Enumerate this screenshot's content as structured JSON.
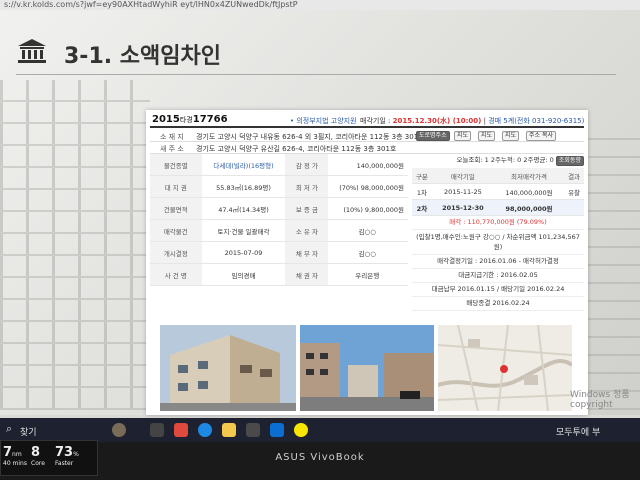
{
  "browser": {
    "url": "s://v.kr.kolds.com/s?jwf=ey90AXHtadWyhiR eyt/lHN0x4ZUNwedDk/ftJpstP"
  },
  "slide": {
    "title": "3-1. 소액임차인"
  },
  "case": {
    "year": "2015",
    "type": "타경",
    "number": "17766",
    "court": "의정부지법 고양지원",
    "sale_label": "매각기일 :",
    "sale_date": "2015.12.30(水) (10:00)",
    "dept": "경매 5계(전화 031-920-6315)"
  },
  "location": {
    "label": "소 재 지",
    "value": "경기도 고양시 덕양구 내유동 626-4 외 3필지, 코리아타운 112동 3층 301호",
    "btn_road": "도로명주소"
  },
  "new_address": {
    "label": "새 주 소",
    "value": "경기도 고양시 덕양구 유산길 626-4, 코리아타운 112동 3층 301호"
  },
  "map_buttons": [
    "지도",
    "지도",
    "지도",
    "주소 복사"
  ],
  "info_rows": [
    {
      "k1": "물건종별",
      "v1": "다세대(빌라)(16평형)",
      "k2": "감 정 가",
      "v2": "140,000,000원"
    },
    {
      "k1": "대 지 권",
      "v1": "55.83㎡(16.89평)",
      "k2": "최 저 가",
      "v2": "(70%) 98,000,000원"
    },
    {
      "k1": "건물면적",
      "v1": "47.4㎡(14.34평)",
      "k2": "보 증 금",
      "v2": "(10%) 9,800,000원"
    },
    {
      "k1": "매각물건",
      "v1": "토지·건물 일괄매각",
      "k2": "소 유 자",
      "v2": "김○○"
    },
    {
      "k1": "개시결정",
      "v1": "2015-07-09",
      "k2": "채 무 자",
      "v2": "김○○"
    },
    {
      "k1": "사 건 명",
      "v1": "임의경매",
      "k2": "채 권 자",
      "v2": "우리은행"
    }
  ],
  "views": {
    "text": "오늘조회: 1  2주누적: 0  2주평균: 0",
    "btn": "조회동향"
  },
  "bids": {
    "headers": [
      "구분",
      "매각기일",
      "최저매각가격",
      "결과"
    ],
    "rows": [
      {
        "c": "1차",
        "d": "2015-11-25",
        "p": "140,000,000원",
        "r": "유찰"
      },
      {
        "c": "2차",
        "d": "2015-12-30",
        "p": "98,000,000원",
        "r": ""
      }
    ]
  },
  "history": {
    "result": "매각 : 110,770,000원 (79.09%)",
    "winner": "(입찰1명,매수인:노원구 강○○ / 차순위금액 101,234,567원)",
    "approve": "매각결정기일 : 2016.01.06 - 매각허가결정",
    "payment_due": "대금지급기한 : 2016.02.05",
    "payment": "대금납부 2016.01.15 / 배당기일 2016.02.24",
    "closed": "배당종결 2016.02.24"
  },
  "taskbar": {
    "search": "찾기",
    "ime": "모두투에 부"
  },
  "widget": {
    "a_val": "7",
    "a_unit": "nm",
    "a_sub": "40 mins",
    "b_val": "8",
    "b_sub": "Core",
    "c_val": "73",
    "c_unit": "%",
    "c_sub": "Faster"
  },
  "bezel": {
    "brand": "ASUS VivoBook"
  },
  "watermark": {
    "line1": "Windows 정품",
    "line2": "copyright"
  }
}
